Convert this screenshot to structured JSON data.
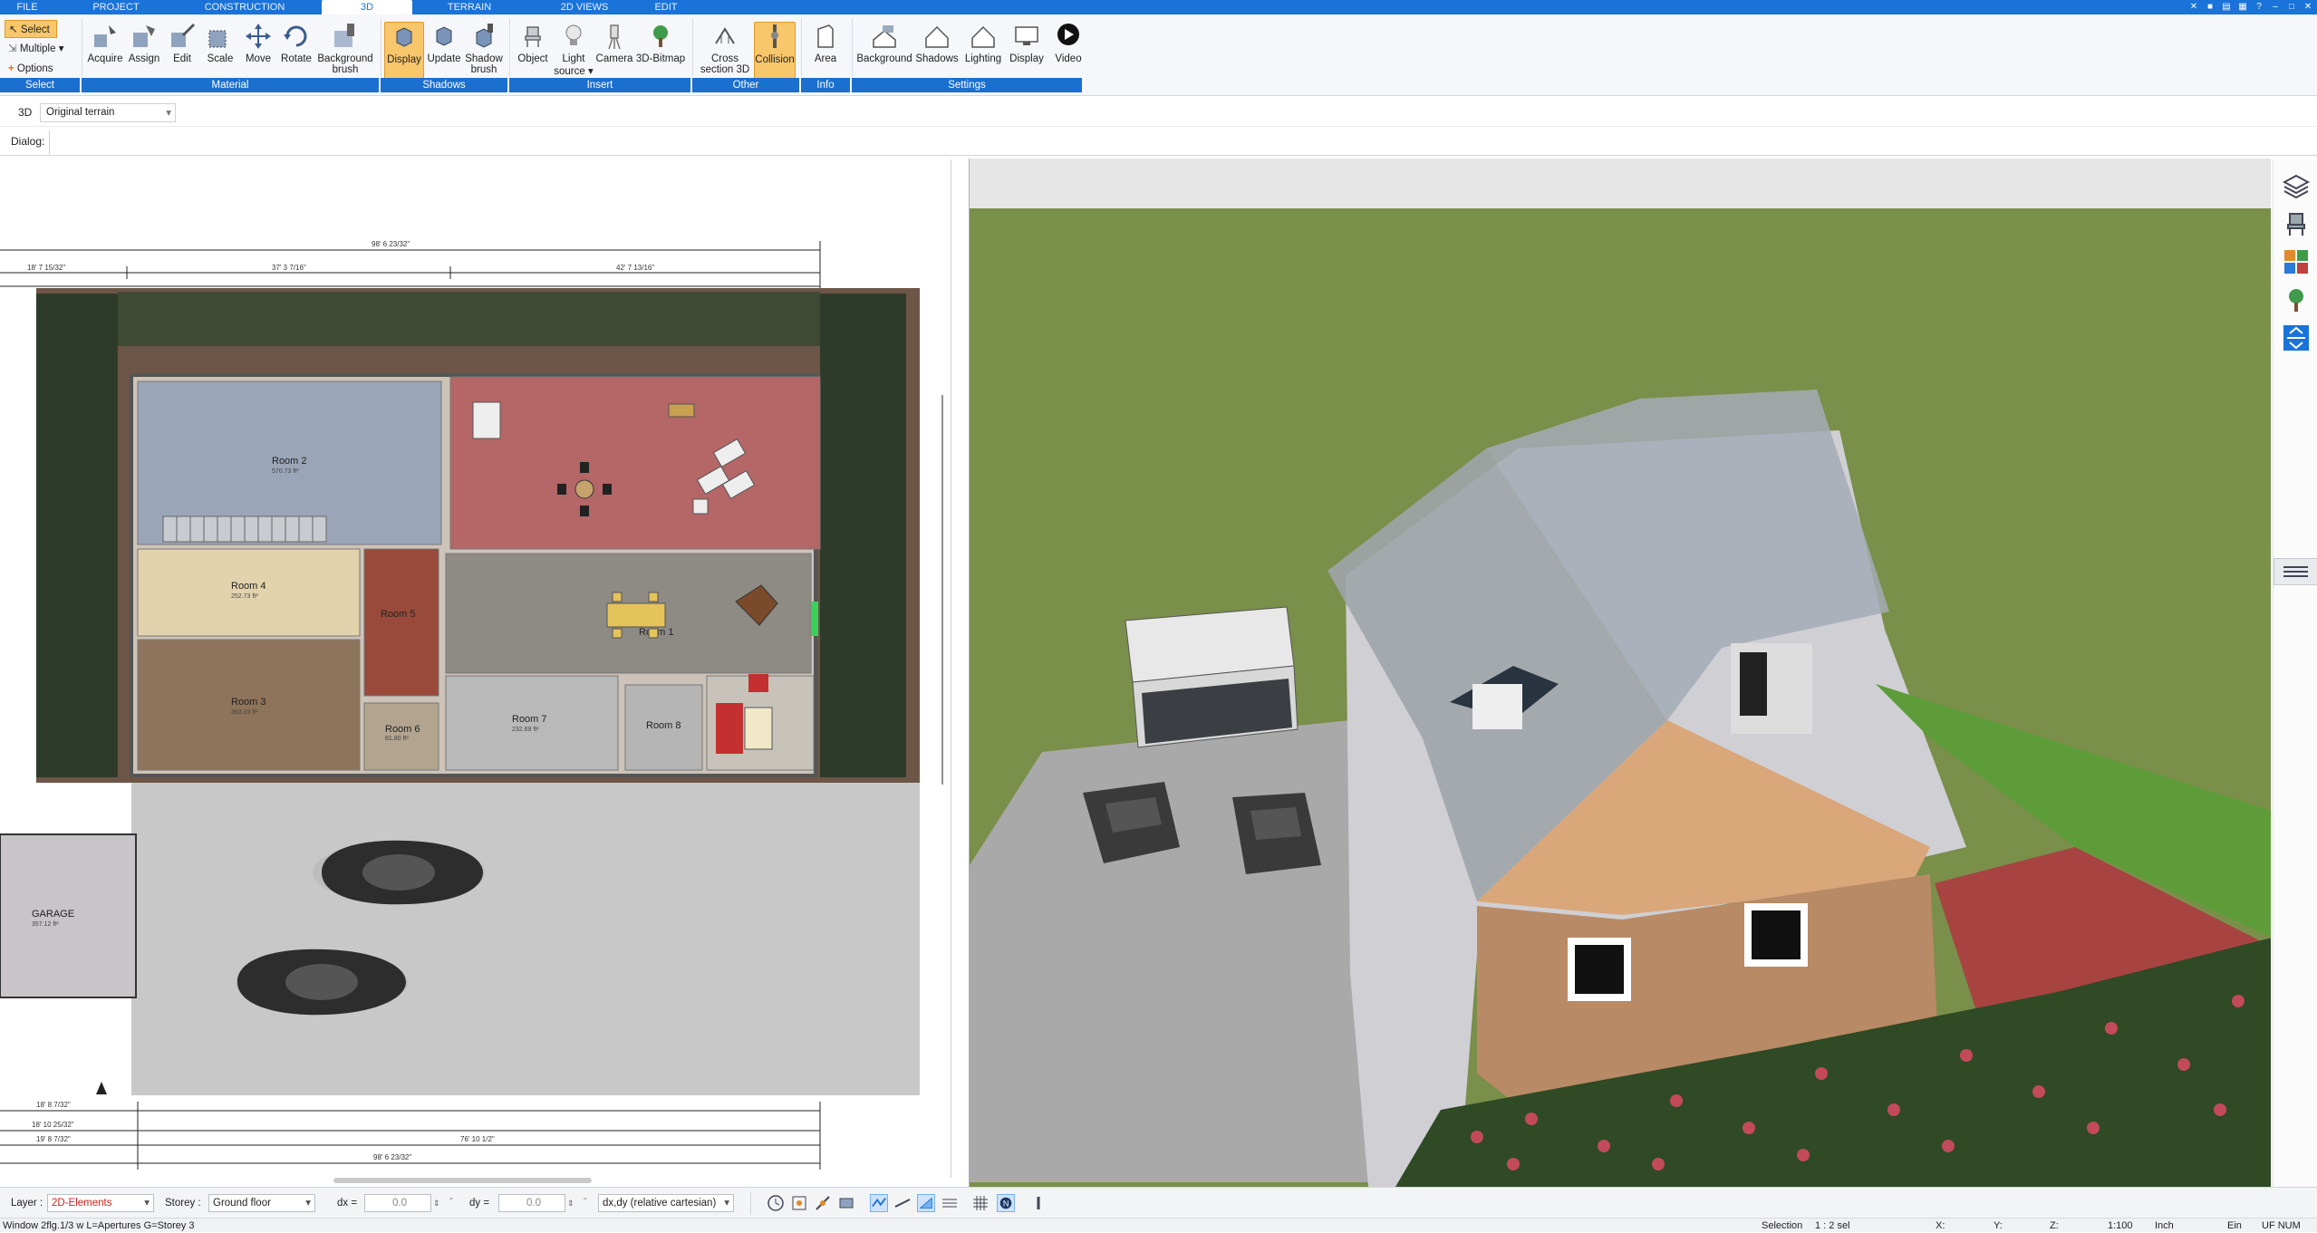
{
  "menu": {
    "tabs": [
      {
        "label": "FILE"
      },
      {
        "label": "PROJECT"
      },
      {
        "label": "CONSTRUCTION"
      },
      {
        "label": "3D"
      },
      {
        "label": "TERRAIN"
      },
      {
        "label": "2D VIEWS"
      },
      {
        "label": "EDIT"
      }
    ],
    "active_tab": "3D"
  },
  "ribbon": {
    "select": {
      "select_label": "Select",
      "multiple_label": "Multiple",
      "options_label": "Options",
      "group": "Select"
    },
    "material": {
      "group": "Material",
      "buttons": [
        "Acquire",
        "Assign",
        "Edit",
        "Scale",
        "Move",
        "Rotate",
        "Background brush"
      ]
    },
    "shadows": {
      "group": "Shadows",
      "buttons": [
        "Display",
        "Update",
        "Shadow brush"
      ]
    },
    "insert": {
      "group": "Insert",
      "buttons": [
        "Object",
        "Light source",
        "Camera",
        "3D-Bitmap"
      ]
    },
    "other": {
      "group": "Other",
      "buttons": [
        "Cross section 3D",
        "Collision"
      ]
    },
    "info": {
      "group": "Info",
      "buttons": [
        "Area"
      ]
    },
    "settings": {
      "group": "Settings",
      "buttons": [
        "Background",
        "Shadows",
        "Lighting",
        "Display",
        "Video"
      ]
    }
  },
  "row2": {
    "mode_label": "3D",
    "terrain_select": "Original terrain"
  },
  "row3": {
    "dialog_label": "Dialog:"
  },
  "plan": {
    "rooms": [
      {
        "name": "Room 2",
        "area": "570.73 ft²"
      },
      {
        "name": "Room 4",
        "area": "252.73 ft²"
      },
      {
        "name": "Room 3",
        "area": "363.33 ft²"
      },
      {
        "name": "Room 1",
        "area": "..."
      },
      {
        "name": "Room 5",
        "area": "..."
      },
      {
        "name": "Room 6",
        "area": "81.80 ft²"
      },
      {
        "name": "Room 7",
        "area": "232.69 ft²"
      },
      {
        "name": "Room 8",
        "area": "..."
      },
      {
        "name": "GARAGE",
        "area": "357.12 ft²"
      }
    ],
    "dims_top": [
      "98' 6 23/32\"",
      "18' 7 15/32\"",
      "37' 3 7/16\"",
      "42' 7 13/16\""
    ],
    "dims_bottom": [
      "18' 8 7/32\"",
      "18' 10 25/32\"",
      "19' 8 7/32\"",
      "98' 6 23/32\"",
      "76' 10 1/2\""
    ]
  },
  "bottombar": {
    "layer_label": "Layer :",
    "layer_value": "2D-Elements",
    "storey_label": "Storey :",
    "storey_value": "Ground floor",
    "dx_label": "dx =",
    "dx_value": "0.0",
    "dy_label": "dy =",
    "dy_value": "0.0",
    "coord_mode": "dx,dy (relative cartesian)"
  },
  "statusbar": {
    "left": "Window 2flg.1/3 w L=Apertures G=Storey 3",
    "selection_label": "Selection",
    "selection_value": "1 : 2 sel",
    "x_label": "X:",
    "y_label": "Y:",
    "z_label": "Z:",
    "scale": "1:100",
    "unit": "Inch",
    "ein": "Ein",
    "flags": "UF NUM"
  },
  "colors": {
    "accent": "#1a73d9",
    "active_button": "#f8c66b",
    "group_label": "#1b6fcf",
    "layer_text": "#d02020"
  }
}
